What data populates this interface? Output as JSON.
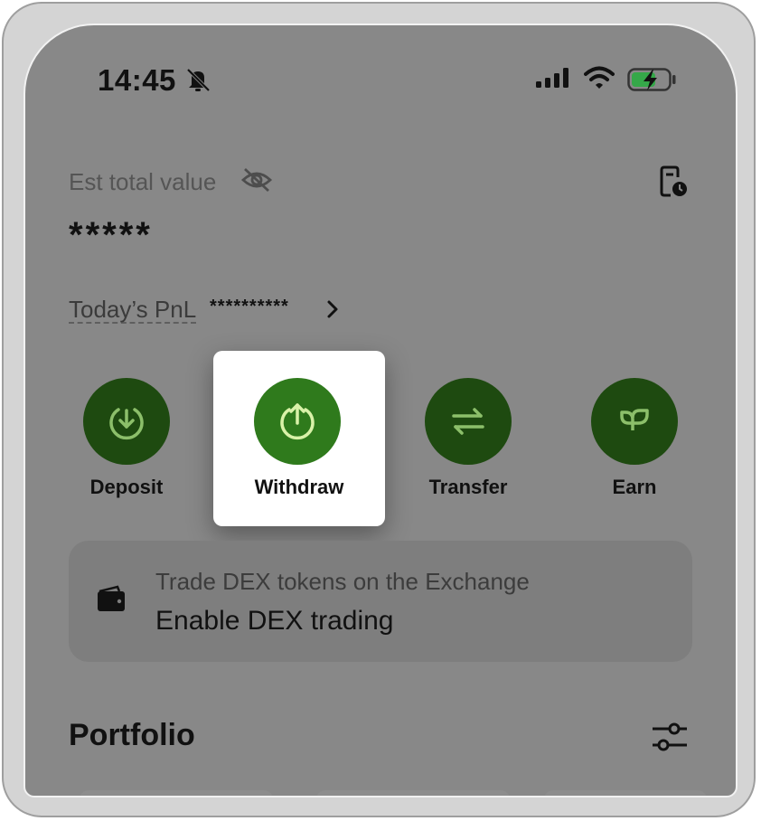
{
  "status_bar": {
    "time": "14:45",
    "icons": [
      "bell-slash-icon",
      "signal-icon",
      "wifi-icon",
      "battery-charging-icon"
    ]
  },
  "header": {
    "est_total_label": "Est total value",
    "total_value": "*****",
    "icons": [
      "eye-off-icon",
      "history-icon"
    ]
  },
  "pnl": {
    "label": "Today’s PnL",
    "value": "**********"
  },
  "actions": [
    {
      "label": "Deposit",
      "icon": "arrow-down-circle-icon"
    },
    {
      "label": "Withdraw",
      "icon": "arrow-up-circle-icon",
      "highlighted": true
    },
    {
      "label": "Transfer",
      "icon": "swap-arrows-icon"
    },
    {
      "label": "Earn",
      "icon": "leaf-icon"
    }
  ],
  "dex_banner": {
    "subtitle": "Trade DEX tokens on the Exchange",
    "title": "Enable DEX trading",
    "icon": "wallet-icon"
  },
  "portfolio": {
    "title": "Portfolio",
    "icon": "filter-sliders-icon"
  },
  "colors": {
    "overlay_background": "#888888",
    "action_circle": "#1e4a10",
    "action_circle_highlight": "#2f7a1c",
    "action_icon": "#8cbf6a",
    "action_icon_highlight": "#d9f2a8"
  }
}
